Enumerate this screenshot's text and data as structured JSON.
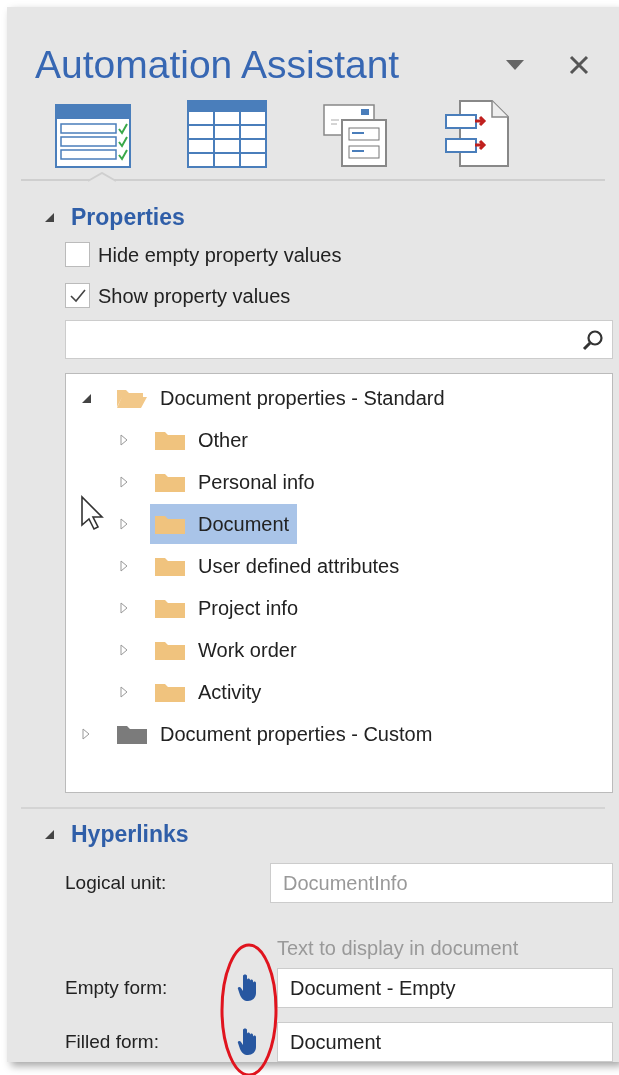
{
  "title": "Automation Assistant",
  "tabs": [
    {
      "kind": "form",
      "selected": true
    },
    {
      "kind": "table",
      "selected": false
    },
    {
      "kind": "layout",
      "selected": false
    },
    {
      "kind": "links",
      "selected": false
    }
  ],
  "properties": {
    "title": "Properties",
    "expanded": true,
    "options": [
      {
        "label": "Hide empty property values",
        "checked": false
      },
      {
        "label": "Show property values",
        "checked": true
      }
    ],
    "tree": [
      {
        "label": "Document properties - Standard",
        "expanded": true,
        "selected": false,
        "color": "#f2c889",
        "children": [
          {
            "label": "Other",
            "expanded": false,
            "selected": false,
            "color": "#f0c37e"
          },
          {
            "label": "Personal info",
            "expanded": false,
            "selected": false,
            "color": "#f0c37e"
          },
          {
            "label": "Document",
            "expanded": false,
            "selected": true,
            "color": "#f0c37e"
          },
          {
            "label": "User defined attributes",
            "expanded": false,
            "selected": false,
            "color": "#f0c37e"
          },
          {
            "label": "Project info",
            "expanded": false,
            "selected": false,
            "color": "#f0c37e"
          },
          {
            "label": "Work order",
            "expanded": false,
            "selected": false,
            "color": "#f0c37e"
          },
          {
            "label": "Activity",
            "expanded": false,
            "selected": false,
            "color": "#f0c37e"
          }
        ]
      },
      {
        "label": "Document properties - Custom",
        "expanded": false,
        "selected": false,
        "color": "#7b7b7b"
      }
    ]
  },
  "hyperlinks": {
    "title": "Hyperlinks",
    "expanded": true,
    "logical_unit": {
      "label": "Logical unit:",
      "placeholder": "DocumentInfo"
    },
    "hint": "Text to display in document",
    "forms": [
      {
        "label": "Empty form:",
        "value": "Document - Empty"
      },
      {
        "label": "Filled form:",
        "value": "Document"
      }
    ]
  }
}
